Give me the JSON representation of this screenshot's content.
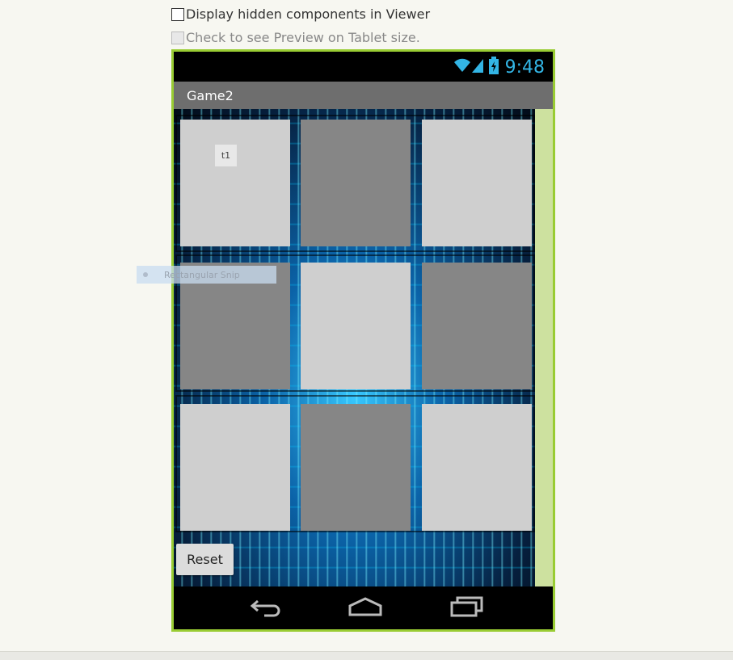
{
  "options": {
    "display_hidden": "Display hidden components in Viewer",
    "tablet_preview": "Check to see Preview on Tablet size."
  },
  "statusbar": {
    "time": "9:48"
  },
  "app": {
    "title": "Game2"
  },
  "tiles": [
    {
      "label": "t1",
      "shade": "light"
    },
    {
      "label": "",
      "shade": "dark"
    },
    {
      "label": "",
      "shade": "light"
    },
    {
      "label": "",
      "shade": "dark"
    },
    {
      "label": "",
      "shade": "light"
    },
    {
      "label": "",
      "shade": "dark"
    },
    {
      "label": "",
      "shade": "light"
    },
    {
      "label": "",
      "shade": "dark"
    },
    {
      "label": "",
      "shade": "light"
    }
  ],
  "reset_label": "Reset",
  "snip_tooltip": "Rectangular Snip",
  "colors": {
    "phone_border": "#99cc33",
    "status_accent": "#33b5e5",
    "appbar": "#6e6e6e"
  }
}
